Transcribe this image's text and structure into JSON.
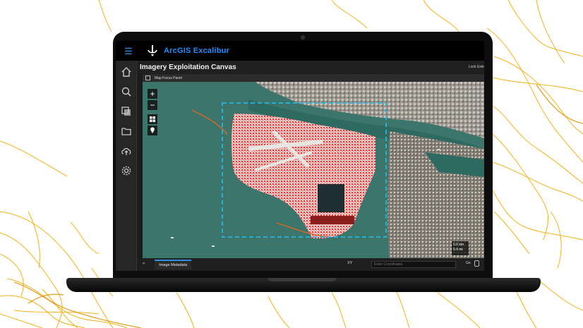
{
  "app": {
    "title": "ArcGIS Excalibur"
  },
  "icons": {
    "menu": "hamburger-icon",
    "logo": "excalibur-sword-icon",
    "nav": [
      "home-icon",
      "search-icon",
      "layers-icon",
      "folder-icon",
      "cloud-upload-icon",
      "gear-icon"
    ]
  },
  "canvas": {
    "title": "Imagery Exploitation Canvas",
    "lock_label": "Lock Extent"
  },
  "panel": {
    "label": "Map Focus Panel"
  },
  "map": {
    "tools": {
      "zoom_in": "+",
      "zoom_out": "−"
    },
    "scale": {
      "line1": "0.6 km",
      "line2": "0.4 mi"
    }
  },
  "bottom": {
    "collapse": "^",
    "tab_label": "Image Metadata",
    "coord_system": "XY",
    "coord_placeholder": "Enter Coordinates",
    "go_label": "Go"
  },
  "colors": {
    "accent": "#1e90ff",
    "roads": "#f2a900",
    "water": "#356e63",
    "change_detection": "#ff2a2a",
    "focus_box": "#27b7e0"
  }
}
